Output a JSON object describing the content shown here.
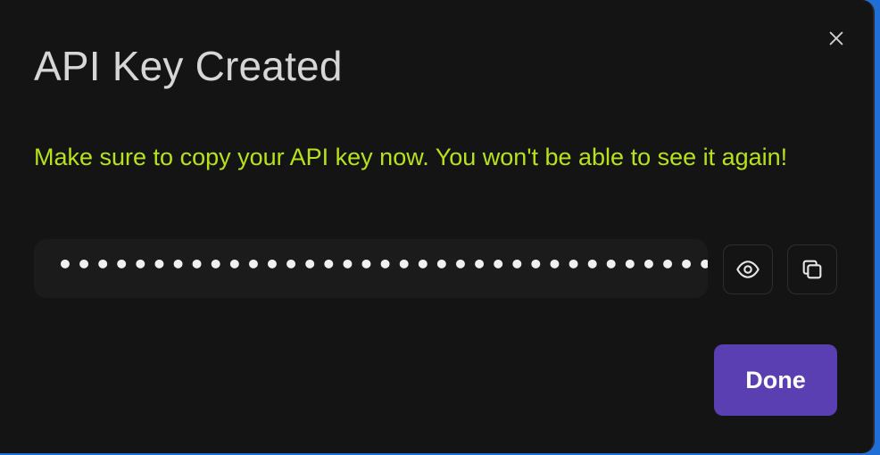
{
  "dialog": {
    "title": "API Key Created",
    "warning": "Make sure to copy your API key now. You won't be able to see it again!",
    "masked_key": "••••••••••••••••••••••••••••••••••••••••",
    "done_label": "Done",
    "icons": {
      "close": "close-icon",
      "reveal": "eye-icon",
      "copy": "copy-icon"
    },
    "colors": {
      "background": "#141414",
      "title": "#d6d6d6",
      "warning": "#b8e21b",
      "primary": "#5a3fb3",
      "field": "#1b1b1b"
    }
  }
}
